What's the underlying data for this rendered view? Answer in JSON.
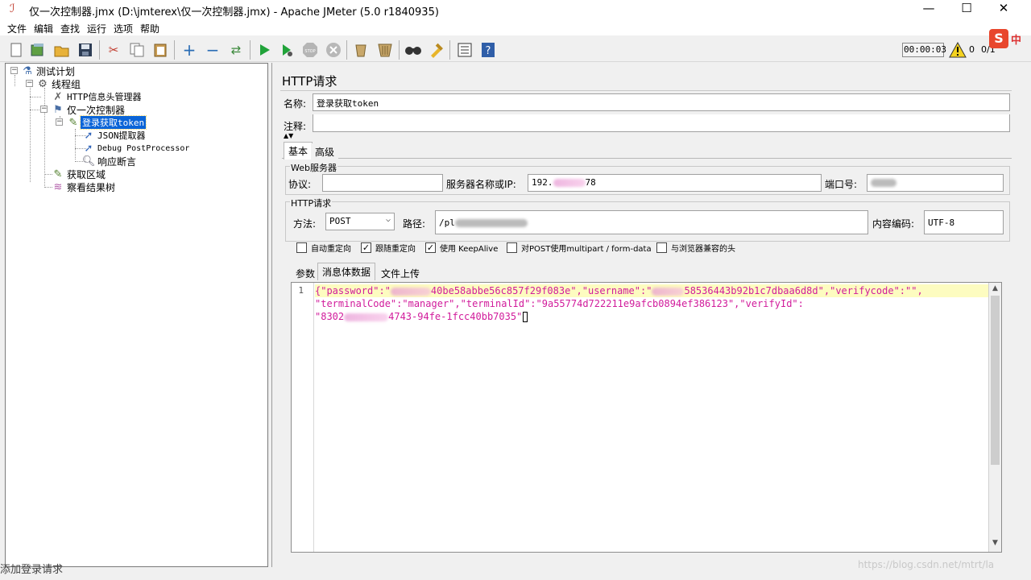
{
  "window": {
    "title": "仅一次控制器.jmx (D:\\jmterex\\仅一次控制器.jmx) - Apache JMeter (5.0 r1840935)",
    "minimize": "—",
    "maximize": "☐",
    "close": "✕"
  },
  "menu": [
    "文件",
    "编辑",
    "查找",
    "运行",
    "选项",
    "帮助"
  ],
  "toolbar": {
    "icons": [
      "new-icon",
      "templates-icon",
      "open-icon",
      "save-icon",
      "cut-icon",
      "copy-icon",
      "paste-icon",
      "expand-icon",
      "collapse-icon",
      "toggle-icon",
      "start-icon",
      "start-no-pause-icon",
      "stop-icon",
      "shutdown-icon",
      "clear-icon",
      "clear-all-icon",
      "search-icon",
      "reset-search-icon",
      "function-helper-icon",
      "help-icon"
    ],
    "timer": "00:00:03",
    "warning_count": "0",
    "threads": "0/1"
  },
  "ime": {
    "logo": "S",
    "mode": "中"
  },
  "tree": {
    "nodes": [
      {
        "label": "测试计划",
        "icon": "test-plan-icon"
      },
      {
        "label": "线程组",
        "icon": "thread-group-icon"
      },
      {
        "label": "HTTP信息头管理器",
        "icon": "header-manager-icon"
      },
      {
        "label": "仅一次控制器",
        "icon": "controller-icon"
      },
      {
        "label": "登录获取token",
        "icon": "http-sampler-icon"
      },
      {
        "label": "JSON提取器",
        "icon": "json-extractor-icon"
      },
      {
        "label": "Debug PostProcessor",
        "icon": "debug-icon"
      },
      {
        "label": "响应断言",
        "icon": "assertion-icon"
      },
      {
        "label": "获取区域",
        "icon": "http-sampler-icon"
      },
      {
        "label": "察看结果树",
        "icon": "results-tree-icon"
      }
    ]
  },
  "panel": {
    "title": "HTTP请求",
    "name_label": "名称:",
    "name_value": "登录获取token",
    "comment_label": "注释:",
    "comment_value": "",
    "tabs": [
      "基本",
      "高级"
    ],
    "web_server": {
      "group_title": "Web服务器",
      "protocol_label": "协议:",
      "protocol_value": "",
      "server_label": "服务器名称或IP:",
      "server_value_start": "192.",
      "server_value_end": "78",
      "port_label": "端口号:"
    },
    "http_request": {
      "group_title": "HTTP请求",
      "method_label": "方法:",
      "method_value": "POST",
      "path_label": "路径:",
      "path_value_start": "/pl",
      "encoding_label": "内容编码:",
      "encoding_value": "UTF-8"
    },
    "checkboxes": [
      {
        "label": "自动重定向",
        "checked": false
      },
      {
        "label": "跟随重定向",
        "checked": true
      },
      {
        "label": "使用 KeepAlive",
        "checked": true
      },
      {
        "label": "对POST使用multipart / form-data",
        "checked": false
      },
      {
        "label": "与浏览器兼容的头",
        "checked": false
      }
    ],
    "body_tabs": [
      "参数",
      "消息体数据",
      "文件上传"
    ],
    "body": {
      "line_number": "1",
      "line1_a": "{\"password\":\"",
      "line1_b": "40be58abbe56c857f29f083e\",\"username\":\"",
      "line1_c": "58536443b92b1c7dbaa6d8",
      "line1_d": "d\",\"verifycode\":\"\",",
      "line2": "\"terminalCode\":\"manager\",\"terminalId\":\"9a55774d722211e9afcb0894ef386123\",\"verifyId\":",
      "line3_a": "\"8302",
      "line3_b": "4743-94fe-1fcc40bb7035\""
    }
  },
  "status_left": "添加登录请求",
  "watermark": "https://blog.csdn.net/mtrt/la"
}
